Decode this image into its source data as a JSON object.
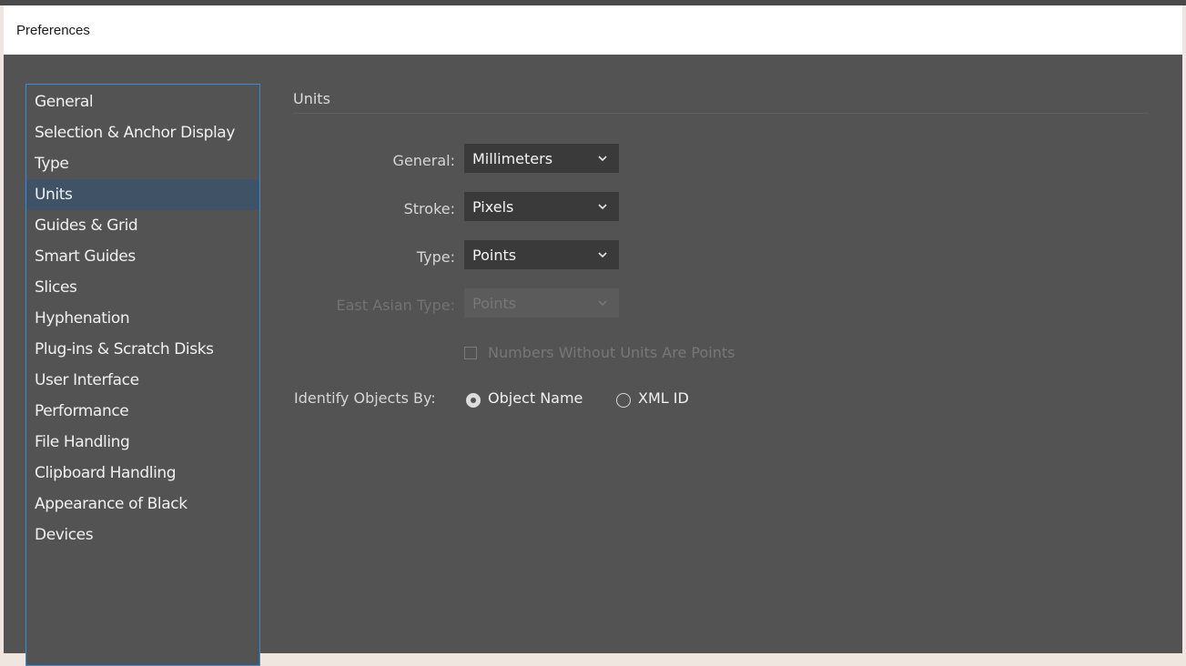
{
  "window": {
    "title": "Preferences"
  },
  "sidebar": {
    "items": [
      {
        "label": "General",
        "selected": false
      },
      {
        "label": "Selection & Anchor Display",
        "selected": false
      },
      {
        "label": "Type",
        "selected": false
      },
      {
        "label": "Units",
        "selected": true
      },
      {
        "label": "Guides & Grid",
        "selected": false
      },
      {
        "label": "Smart Guides",
        "selected": false
      },
      {
        "label": "Slices",
        "selected": false
      },
      {
        "label": "Hyphenation",
        "selected": false
      },
      {
        "label": "Plug-ins & Scratch Disks",
        "selected": false
      },
      {
        "label": "User Interface",
        "selected": false
      },
      {
        "label": "Performance",
        "selected": false
      },
      {
        "label": "File Handling",
        "selected": false
      },
      {
        "label": "Clipboard Handling",
        "selected": false
      },
      {
        "label": "Appearance of Black",
        "selected": false
      },
      {
        "label": "Devices",
        "selected": false
      }
    ]
  },
  "main": {
    "section_title": "Units",
    "general": {
      "label": "General:",
      "value": "Millimeters"
    },
    "stroke": {
      "label": "Stroke:",
      "value": "Pixels"
    },
    "type": {
      "label": "Type:",
      "value": "Points"
    },
    "east_asian_type": {
      "label": "East Asian Type:",
      "value": "Points",
      "disabled": true
    },
    "numbers_without_units": {
      "label": "Numbers Without Units Are Points",
      "checked": false,
      "disabled": true
    },
    "identify_objects": {
      "label": "Identify Objects By:",
      "options": [
        "Object Name",
        "XML ID"
      ],
      "selected": "Object Name"
    }
  },
  "colors": {
    "panel_background": "#535353",
    "selected_item": "#3f5266",
    "focus_border": "#3d8ad9",
    "dropdown_background": "#3a3a3a"
  },
  "icons": {
    "dropdown": "chevron-down-icon",
    "radio_on": "radio-selected-icon",
    "radio_off": "radio-unselected-icon"
  }
}
